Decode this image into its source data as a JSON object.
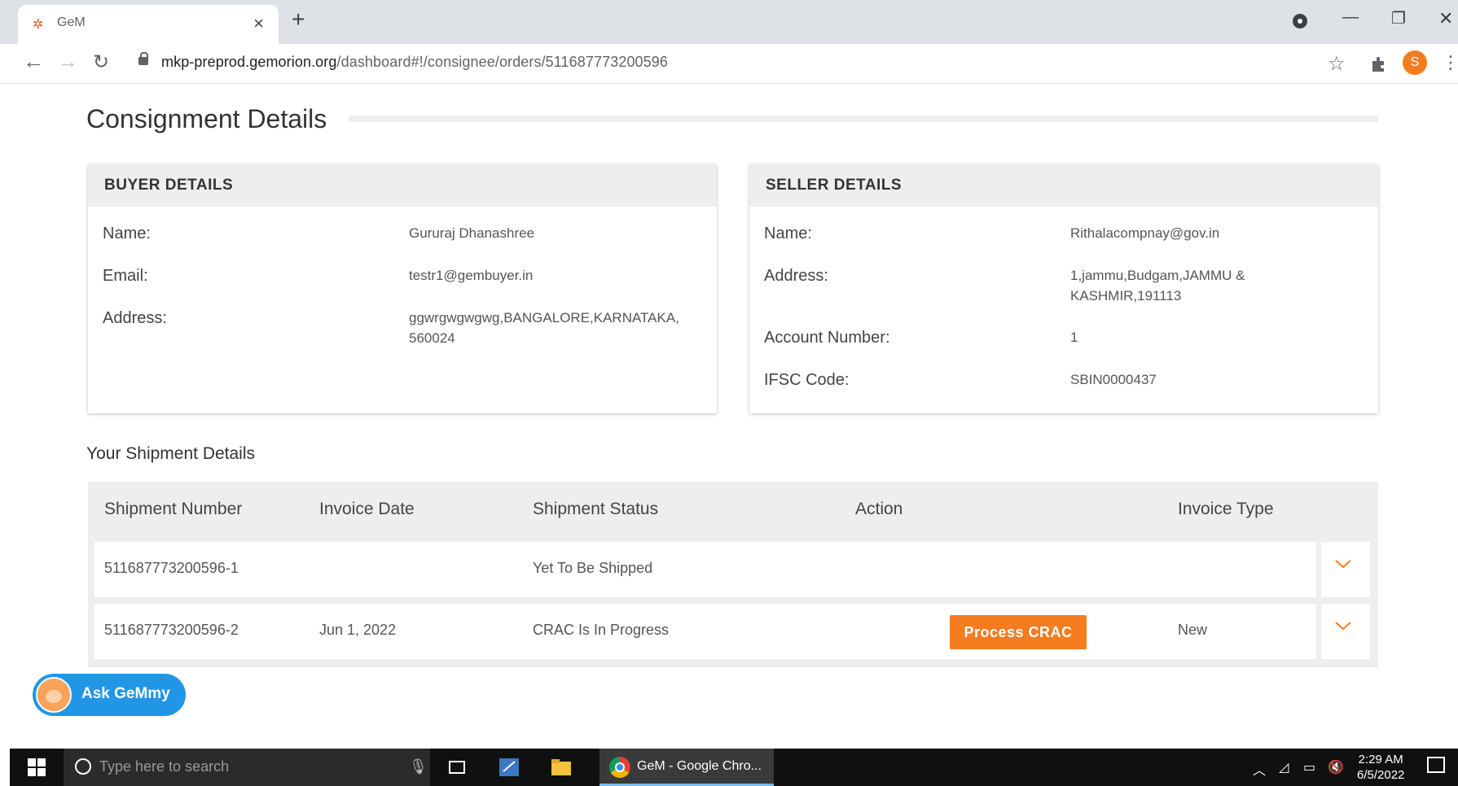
{
  "browser": {
    "tab_title": "GeM",
    "url_host": "mkp-preprod.gemorion.org",
    "url_path": "/dashboard#!/consignee/orders/511687773200596"
  },
  "page": {
    "title": "Consignment Details"
  },
  "buyer": {
    "heading": "BUYER DETAILS",
    "name_label": "Name:",
    "name": "Gururaj Dhanashree",
    "email_label": "Email:",
    "email": "testr1@gembuyer.in",
    "address_label": "Address:",
    "address_line1": "ggwrgwgwgwg,BANGALORE,KARNATAKA,",
    "address_line2": "560024"
  },
  "seller": {
    "heading": "SELLER DETAILS",
    "name_label": "Name:",
    "name": "Rithalacompnay@gov.in",
    "address_label": "Address:",
    "address_line1": "1,jammu,Budgam,JAMMU &",
    "address_line2": "KASHMIR,191113",
    "account_label": "Account Number:",
    "account": "1",
    "ifsc_label": "IFSC Code:",
    "ifsc": "SBIN0000437"
  },
  "shipments": {
    "heading": "Your Shipment Details",
    "columns": {
      "number": "Shipment Number",
      "date": "Invoice Date",
      "status": "Shipment Status",
      "action": "Action",
      "type": "Invoice Type"
    },
    "rows": [
      {
        "number": "511687773200596-1",
        "date": "",
        "status": "Yet To Be Shipped",
        "action": "",
        "type": ""
      },
      {
        "number": "511687773200596-2",
        "date": "Jun 1, 2022",
        "status": "CRAC Is In Progress",
        "action": "Process CRAC",
        "type": "New"
      }
    ]
  },
  "assistant": {
    "label": "Ask GeMmy"
  },
  "taskbar": {
    "search_placeholder": "Type here to search",
    "chrome_label": "GeM - Google Chro...",
    "time": "2:29 AM",
    "date": "6/5/2022"
  },
  "colors": {
    "accent_orange": "#f57c1f",
    "assistant_blue": "#2196e6",
    "card_header_grey": "#eeeeee"
  }
}
